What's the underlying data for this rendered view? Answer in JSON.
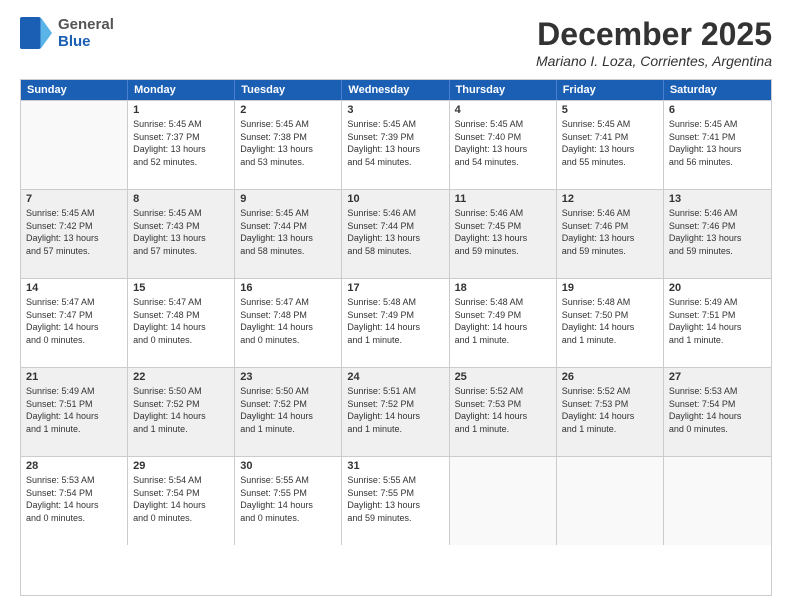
{
  "logo": {
    "line1": "General",
    "line2": "Blue"
  },
  "title": "December 2025",
  "location": "Mariano I. Loza, Corrientes, Argentina",
  "days": [
    "Sunday",
    "Monday",
    "Tuesday",
    "Wednesday",
    "Thursday",
    "Friday",
    "Saturday"
  ],
  "weeks": [
    [
      {
        "num": "",
        "info": ""
      },
      {
        "num": "1",
        "info": "Sunrise: 5:45 AM\nSunset: 7:37 PM\nDaylight: 13 hours\nand 52 minutes."
      },
      {
        "num": "2",
        "info": "Sunrise: 5:45 AM\nSunset: 7:38 PM\nDaylight: 13 hours\nand 53 minutes."
      },
      {
        "num": "3",
        "info": "Sunrise: 5:45 AM\nSunset: 7:39 PM\nDaylight: 13 hours\nand 54 minutes."
      },
      {
        "num": "4",
        "info": "Sunrise: 5:45 AM\nSunset: 7:40 PM\nDaylight: 13 hours\nand 54 minutes."
      },
      {
        "num": "5",
        "info": "Sunrise: 5:45 AM\nSunset: 7:41 PM\nDaylight: 13 hours\nand 55 minutes."
      },
      {
        "num": "6",
        "info": "Sunrise: 5:45 AM\nSunset: 7:41 PM\nDaylight: 13 hours\nand 56 minutes."
      }
    ],
    [
      {
        "num": "7",
        "info": "Sunrise: 5:45 AM\nSunset: 7:42 PM\nDaylight: 13 hours\nand 57 minutes."
      },
      {
        "num": "8",
        "info": "Sunrise: 5:45 AM\nSunset: 7:43 PM\nDaylight: 13 hours\nand 57 minutes."
      },
      {
        "num": "9",
        "info": "Sunrise: 5:45 AM\nSunset: 7:44 PM\nDaylight: 13 hours\nand 58 minutes."
      },
      {
        "num": "10",
        "info": "Sunrise: 5:46 AM\nSunset: 7:44 PM\nDaylight: 13 hours\nand 58 minutes."
      },
      {
        "num": "11",
        "info": "Sunrise: 5:46 AM\nSunset: 7:45 PM\nDaylight: 13 hours\nand 59 minutes."
      },
      {
        "num": "12",
        "info": "Sunrise: 5:46 AM\nSunset: 7:46 PM\nDaylight: 13 hours\nand 59 minutes."
      },
      {
        "num": "13",
        "info": "Sunrise: 5:46 AM\nSunset: 7:46 PM\nDaylight: 13 hours\nand 59 minutes."
      }
    ],
    [
      {
        "num": "14",
        "info": "Sunrise: 5:47 AM\nSunset: 7:47 PM\nDaylight: 14 hours\nand 0 minutes."
      },
      {
        "num": "15",
        "info": "Sunrise: 5:47 AM\nSunset: 7:48 PM\nDaylight: 14 hours\nand 0 minutes."
      },
      {
        "num": "16",
        "info": "Sunrise: 5:47 AM\nSunset: 7:48 PM\nDaylight: 14 hours\nand 0 minutes."
      },
      {
        "num": "17",
        "info": "Sunrise: 5:48 AM\nSunset: 7:49 PM\nDaylight: 14 hours\nand 1 minute."
      },
      {
        "num": "18",
        "info": "Sunrise: 5:48 AM\nSunset: 7:49 PM\nDaylight: 14 hours\nand 1 minute."
      },
      {
        "num": "19",
        "info": "Sunrise: 5:48 AM\nSunset: 7:50 PM\nDaylight: 14 hours\nand 1 minute."
      },
      {
        "num": "20",
        "info": "Sunrise: 5:49 AM\nSunset: 7:51 PM\nDaylight: 14 hours\nand 1 minute."
      }
    ],
    [
      {
        "num": "21",
        "info": "Sunrise: 5:49 AM\nSunset: 7:51 PM\nDaylight: 14 hours\nand 1 minute."
      },
      {
        "num": "22",
        "info": "Sunrise: 5:50 AM\nSunset: 7:52 PM\nDaylight: 14 hours\nand 1 minute."
      },
      {
        "num": "23",
        "info": "Sunrise: 5:50 AM\nSunset: 7:52 PM\nDaylight: 14 hours\nand 1 minute."
      },
      {
        "num": "24",
        "info": "Sunrise: 5:51 AM\nSunset: 7:52 PM\nDaylight: 14 hours\nand 1 minute."
      },
      {
        "num": "25",
        "info": "Sunrise: 5:52 AM\nSunset: 7:53 PM\nDaylight: 14 hours\nand 1 minute."
      },
      {
        "num": "26",
        "info": "Sunrise: 5:52 AM\nSunset: 7:53 PM\nDaylight: 14 hours\nand 1 minute."
      },
      {
        "num": "27",
        "info": "Sunrise: 5:53 AM\nSunset: 7:54 PM\nDaylight: 14 hours\nand 0 minutes."
      }
    ],
    [
      {
        "num": "28",
        "info": "Sunrise: 5:53 AM\nSunset: 7:54 PM\nDaylight: 14 hours\nand 0 minutes."
      },
      {
        "num": "29",
        "info": "Sunrise: 5:54 AM\nSunset: 7:54 PM\nDaylight: 14 hours\nand 0 minutes."
      },
      {
        "num": "30",
        "info": "Sunrise: 5:55 AM\nSunset: 7:55 PM\nDaylight: 14 hours\nand 0 minutes."
      },
      {
        "num": "31",
        "info": "Sunrise: 5:55 AM\nSunset: 7:55 PM\nDaylight: 13 hours\nand 59 minutes."
      },
      {
        "num": "",
        "info": ""
      },
      {
        "num": "",
        "info": ""
      },
      {
        "num": "",
        "info": ""
      }
    ]
  ]
}
